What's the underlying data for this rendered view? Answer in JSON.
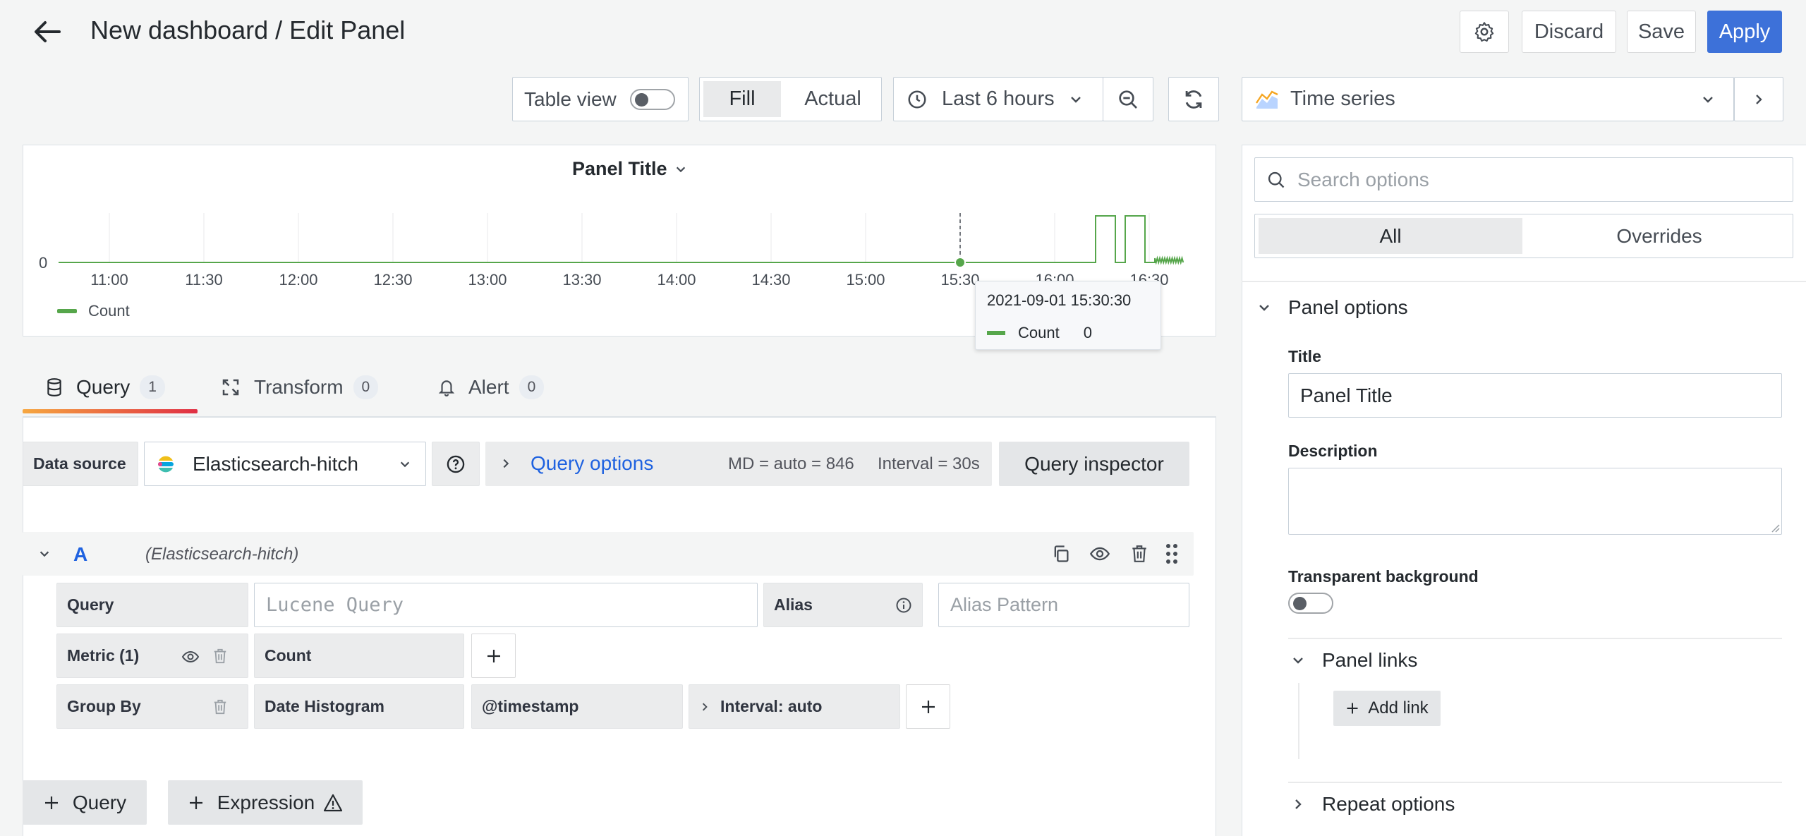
{
  "header": {
    "title": "New dashboard / Edit Panel",
    "discard_label": "Discard",
    "save_label": "Save",
    "apply_label": "Apply"
  },
  "toolbar": {
    "table_view_label": "Table view",
    "fill_label": "Fill",
    "actual_label": "Actual",
    "time_range_label": "Last 6 hours",
    "visualization_label": "Time series"
  },
  "panel": {
    "title": "Panel Title",
    "tooltip": {
      "time": "2021-09-01 15:30:30",
      "series": "Count",
      "value": "0"
    },
    "legend": "Count",
    "series_color": "#56a64b"
  },
  "chart_data": {
    "type": "line",
    "x_ticks": [
      "11:00",
      "11:30",
      "12:00",
      "12:30",
      "13:00",
      "13:30",
      "14:00",
      "14:30",
      "15:00",
      "15:30",
      "16:00",
      "16:30"
    ],
    "y_ticks": [
      "0"
    ],
    "series": [
      {
        "name": "Count",
        "values": [
          0,
          0,
          0,
          0,
          0,
          0,
          0,
          0,
          0,
          0,
          0,
          1,
          1,
          0,
          1,
          1,
          0,
          0.1,
          0.1,
          0.1
        ]
      }
    ]
  },
  "tabs": [
    {
      "label": "Query",
      "count": "1"
    },
    {
      "label": "Transform",
      "count": "0"
    },
    {
      "label": "Alert",
      "count": "0"
    }
  ],
  "query_bar": {
    "data_source_label": "Data source",
    "data_source_value": "Elasticsearch-hitch",
    "query_options_label": "Query options",
    "md_info": "MD = auto = 846",
    "interval_info": "Interval = 30s",
    "inspector_label": "Query inspector"
  },
  "query_row": {
    "ref_id": "A",
    "source_name": "(Elasticsearch-hitch)",
    "query_label": "Query",
    "query_placeholder": "Lucene Query",
    "alias_label": "Alias",
    "alias_placeholder": "Alias Pattern",
    "metric_label": "Metric (1)",
    "metric_value": "Count",
    "group_by_label": "Group By",
    "group_by_type": "Date Histogram",
    "group_by_field": "@timestamp",
    "interval_label": "Interval: auto"
  },
  "bottom_buttons": {
    "query_label": "Query",
    "expression_label": "Expression"
  },
  "options": {
    "search_placeholder": "Search options",
    "all_label": "All",
    "overrides_label": "Overrides",
    "panel_options_label": "Panel options",
    "title_label": "Title",
    "title_value": "Panel Title",
    "description_label": "Description",
    "transparent_label": "Transparent background",
    "panel_links_label": "Panel links",
    "add_link_label": "Add link",
    "repeat_options_label": "Repeat options"
  }
}
